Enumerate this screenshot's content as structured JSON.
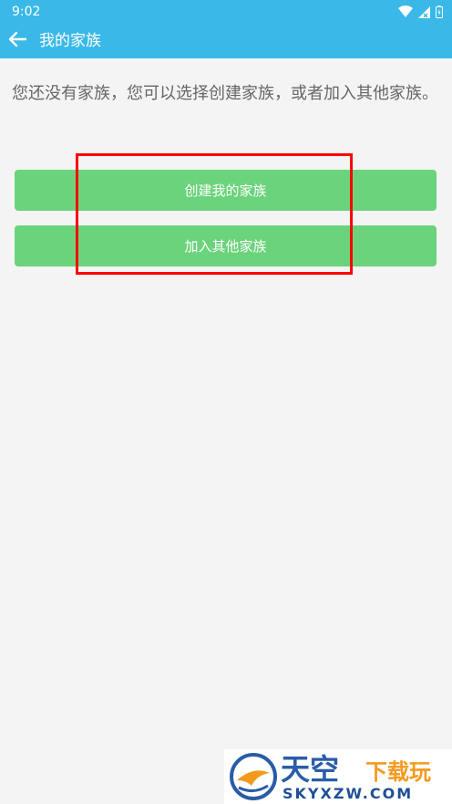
{
  "status_bar": {
    "time": "9:02",
    "icons": [
      "wifi-icon",
      "signal-icon",
      "battery-icon"
    ]
  },
  "app_bar": {
    "back_icon": "arrow-left-icon",
    "title": "我的家族"
  },
  "main": {
    "message": "您还没有家族，您可以选择创建家族，或者加入其他家族。",
    "buttons": {
      "create": "创建我的家族",
      "join": "加入其他家族"
    }
  },
  "watermark": {
    "title": "天空",
    "subtitle": "下载玩",
    "domain": "SKYXZW.COM"
  },
  "colors": {
    "header": "#3ab9e8",
    "button": "#6bd37c",
    "highlight": "#ff0000",
    "background": "#f4f4f4",
    "message_text": "#666666"
  }
}
